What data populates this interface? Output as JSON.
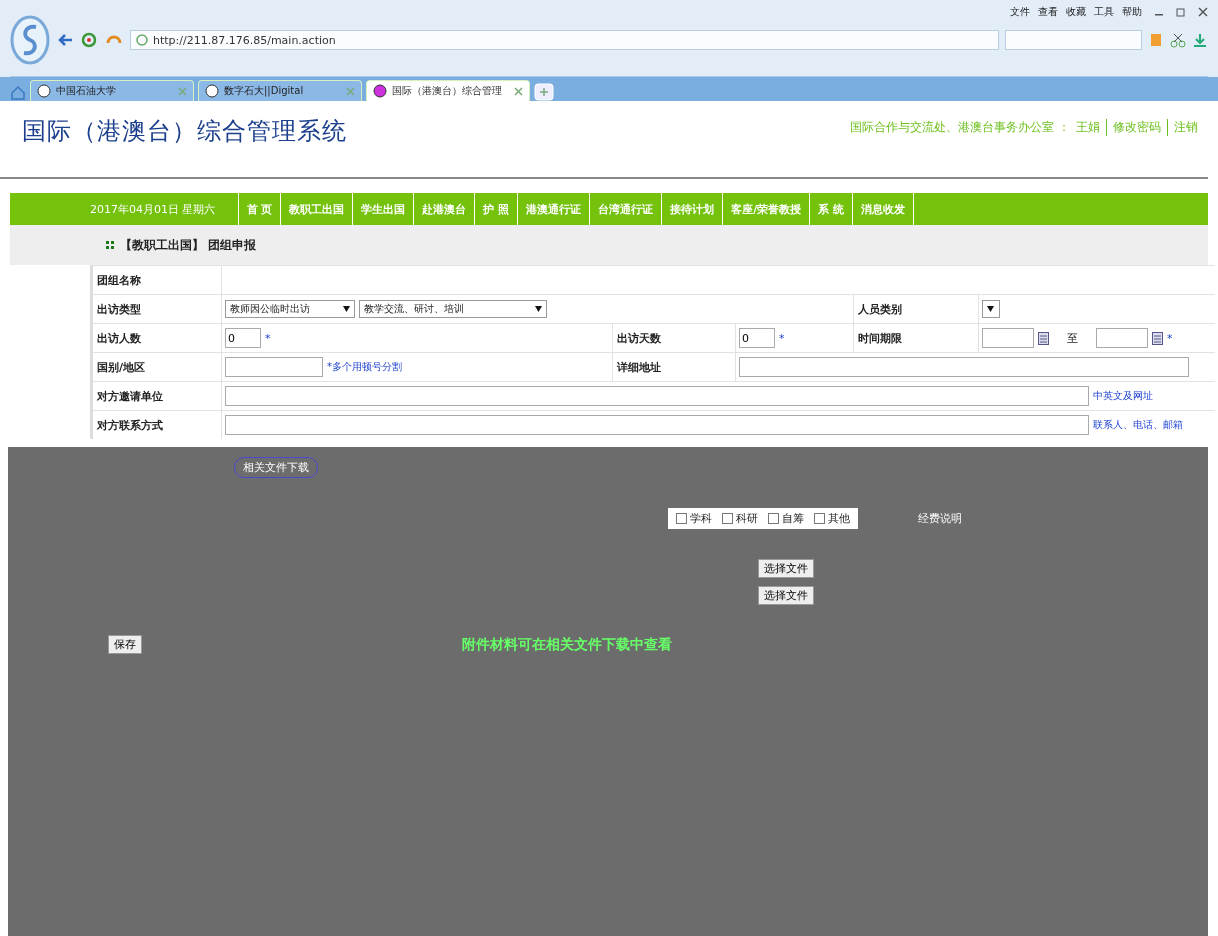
{
  "browser": {
    "menu": [
      "文件",
      "查看",
      "收藏",
      "工具",
      "帮助"
    ],
    "address": "http://211.87.176.85/main.action",
    "tabs": [
      {
        "label": "中国石油大学",
        "selected": false
      },
      {
        "label": "数字石大||Digital",
        "selected": false
      },
      {
        "label": "国际（港澳台）综合管理",
        "selected": true
      }
    ]
  },
  "header": {
    "title": "国际（港澳台）综合管理系统",
    "office": "国际合作与交流处、港澳台事务办公室 ：",
    "user": "王娟",
    "links": [
      "修改密码",
      "注销"
    ]
  },
  "nav": {
    "date": "2017年04月01日 星期六",
    "items": [
      "首 页",
      "教职工出国",
      "学生出国",
      "赴港澳台",
      "护 照",
      "港澳通行证",
      "台湾通行证",
      "接待计划",
      "客座/荣誉教授",
      "系 统",
      "消息收发"
    ]
  },
  "breadcrumb": {
    "section": "【教职工出国】",
    "page": "团组申报"
  },
  "form": {
    "group_name": {
      "label": "团组名称"
    },
    "visit_type": {
      "label": "出访类型",
      "value": "教师因公临时出访",
      "subtype": "教学交流、研讨、培训"
    },
    "staff_category": {
      "label": "人员类别"
    },
    "visitors": {
      "label": "出访人数",
      "value": "0",
      "mark": "*"
    },
    "days": {
      "label": "出访天数",
      "value": "0",
      "mark": "*"
    },
    "period": {
      "label": "时间期限",
      "separator": "至",
      "mark": "*"
    },
    "country": {
      "label": "国别/地区",
      "hint": "*多个用顿号分割"
    },
    "address": {
      "label": "详细地址"
    },
    "inviter": {
      "label": "对方邀请单位",
      "hint": "中英文及网址"
    },
    "contact": {
      "label": "对方联系方式",
      "hint": "联系人、电话、邮箱"
    }
  },
  "lower": {
    "downloads": "相关文件下载",
    "funding": [
      {
        "label": "学科",
        "checked": false
      },
      {
        "label": "科研",
        "checked": false
      },
      {
        "label": "自筹",
        "checked": false
      },
      {
        "label": "其他",
        "checked": false
      }
    ],
    "funding_note": "经费说明",
    "file_buttons": [
      "选择文件",
      "选择文件"
    ],
    "save": "保存",
    "notice": "附件材料可在相关文件下载中查看"
  }
}
